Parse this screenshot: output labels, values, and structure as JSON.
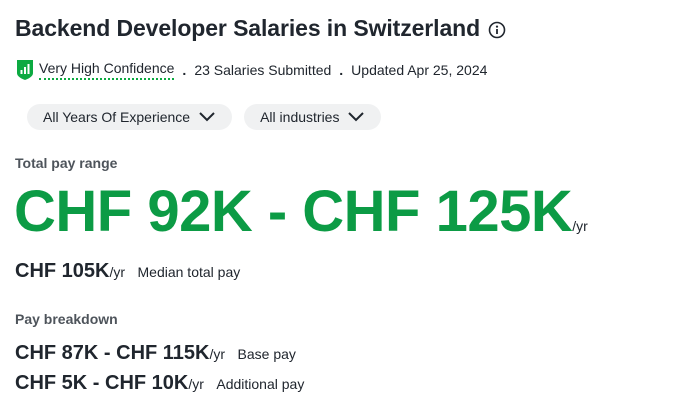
{
  "title": "Backend Developer Salaries in Switzerland",
  "meta": {
    "confidence": "Very High Confidence",
    "separator": ".",
    "submitted": "23 Salaries Submitted",
    "updated": "Updated Apr 25, 2024"
  },
  "filters": {
    "experience": "All Years Of Experience",
    "industries": "All industries"
  },
  "total_pay": {
    "label": "Total pay range",
    "range": "CHF 92K - CHF 125K",
    "unit": "/yr",
    "median_value": "CHF 105K",
    "median_unit": "/yr",
    "median_label": "Median total pay"
  },
  "breakdown": {
    "label": "Pay breakdown",
    "base_value": "CHF 87K - CHF 115K",
    "base_unit": "/yr",
    "base_label": "Base pay",
    "additional_value": "CHF 5K - CHF 10K",
    "additional_unit": "/yr",
    "additional_label": "Additional pay"
  },
  "colors": {
    "accent": "#0c9b45",
    "text": "#20262e",
    "pill": "#f0f1f2"
  },
  "icons": [
    "info-icon",
    "confidence-icon",
    "chevron-down-icon"
  ]
}
